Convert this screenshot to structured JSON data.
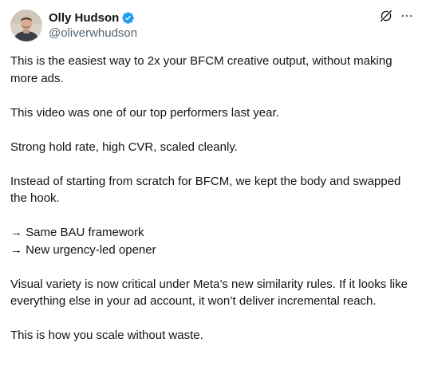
{
  "author": {
    "display_name": "Olly Hudson",
    "handle": "@oliverwhudson",
    "verified": true,
    "accent_color": "#1d9bf0"
  },
  "header_actions": {
    "grok_icon": "grok-icon",
    "more_icon": "more-icon"
  },
  "post": {
    "paragraphs": [
      "This is the easiest way to 2x your BFCM creative output, without making more ads.",
      "This video was one of our top performers last year.",
      "Strong hold rate, high CVR, scaled cleanly.",
      "Instead of starting from scratch for BFCM, we kept the body and swapped the hook."
    ],
    "list_items": [
      "→ Same BAU framework",
      "→ New urgency-led opener"
    ],
    "closing_paragraphs": [
      "Visual variety is now critical under Meta’s new similarity rules. If it looks like everything else in your ad account, it won’t deliver incremental reach.",
      "This is how you scale without waste."
    ]
  },
  "colors": {
    "text": "#0f1419",
    "secondary": "#536471",
    "background": "#ffffff"
  }
}
